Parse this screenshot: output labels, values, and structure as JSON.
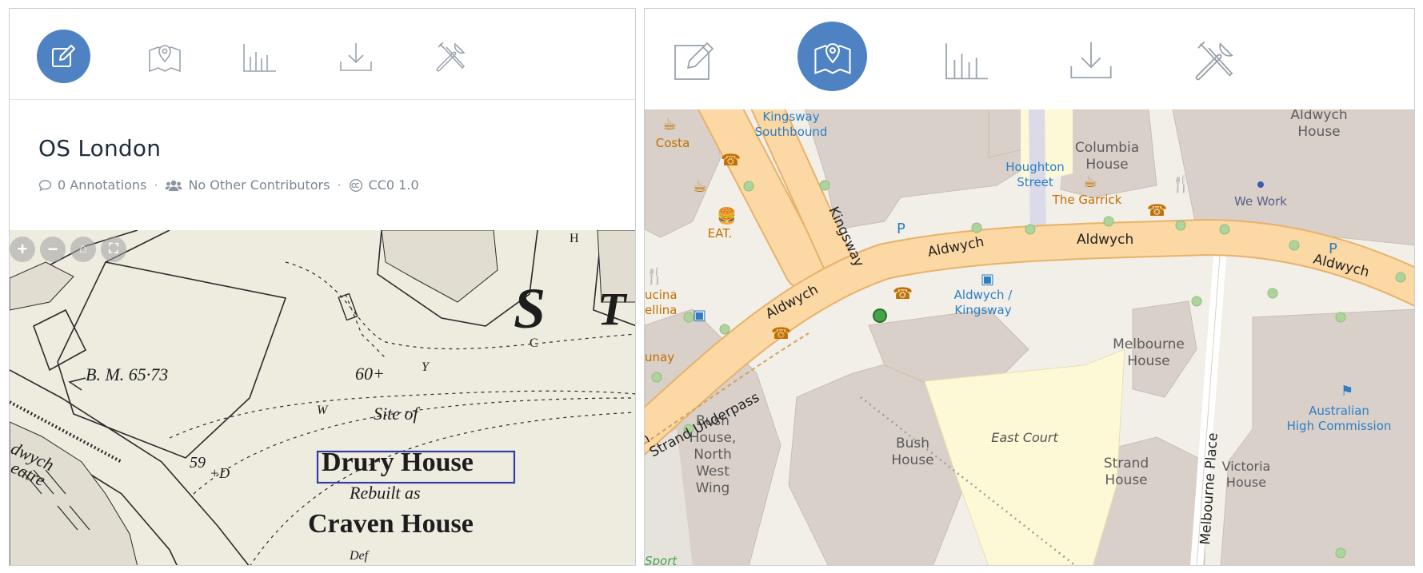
{
  "colors": {
    "accent": "#4f82c2",
    "icon_gray": "#9aa3ad",
    "osm_road": "#fbd8a4",
    "osm_building": "#d9d0c9",
    "osm_label_blue": "#2c7ec6"
  },
  "left_panel": {
    "toolbar": [
      {
        "icon": "edit-icon",
        "active": true
      },
      {
        "icon": "map-icon",
        "active": false
      },
      {
        "icon": "bar-chart-icon",
        "active": false
      },
      {
        "icon": "download-icon",
        "active": false
      },
      {
        "icon": "tools-icon",
        "active": false
      }
    ],
    "title": "OS London",
    "meta": {
      "annotations": "0 Annotations",
      "contributors": "No Other Contributors",
      "license": "CC0 1.0",
      "separator": "·"
    },
    "map": {
      "zoom_controls": [
        "+",
        "−",
        "⌂",
        "⛶"
      ],
      "labels": {
        "benchmark": "B. M. 65·73",
        "height1": "60+",
        "height2": "59",
        "d": "+D",
        "y": "Y",
        "w": "W",
        "site_of": "Site of",
        "drury": "Drury House",
        "rebuilt": "Rebuilt as",
        "craven": "Craven House",
        "def": "Def",
        "theatre1": "dwych",
        "theatre2": "eatre",
        "big_s": "S",
        "big_t": "T",
        "c_label": "C",
        "h_label": "H"
      }
    }
  },
  "right_panel": {
    "toolbar": [
      {
        "icon": "edit-icon",
        "active": false
      },
      {
        "icon": "map-icon",
        "active": true
      },
      {
        "icon": "bar-chart-icon",
        "active": false
      },
      {
        "icon": "download-icon",
        "active": false
      },
      {
        "icon": "tools-icon",
        "active": false
      }
    ],
    "map_labels": {
      "kingsway_southbound": [
        "Kingsway",
        "Southbound"
      ],
      "costa": "Costa",
      "eat": "EAT.",
      "cucina": [
        "ucina",
        "ellina"
      ],
      "unay": "unay",
      "columbia": [
        "Columbia",
        "House"
      ],
      "houghton": [
        "Houghton",
        "Street"
      ],
      "garrick": "The Garrick",
      "wework": "We Work",
      "aldwych_house": [
        "Aldwych",
        "House"
      ],
      "kingsway": "Kingsway",
      "aldwych1": "Aldwych",
      "aldwych2": "Aldwych",
      "aldwych3": "Aldwych",
      "aldwych4": "Aldwych",
      "aldwych_kingsway": [
        "Aldwych /",
        "Kingsway"
      ],
      "strand_underpass": "Strand Underpass",
      "strand_short": "n",
      "melbourne_house": [
        "Melbourne",
        "House"
      ],
      "melbourne_place": "Melbourne Place",
      "east_court": "East Court",
      "bush_house": [
        "Bush",
        "House"
      ],
      "bush_house_nw": [
        "Bush",
        "House,",
        "North",
        "West",
        "Wing"
      ],
      "strand_house": [
        "Strand",
        "House"
      ],
      "victoria_house": [
        "Victoria",
        "House"
      ],
      "australian": [
        "Australian",
        "High Commission"
      ],
      "sport": "Sport"
    }
  }
}
